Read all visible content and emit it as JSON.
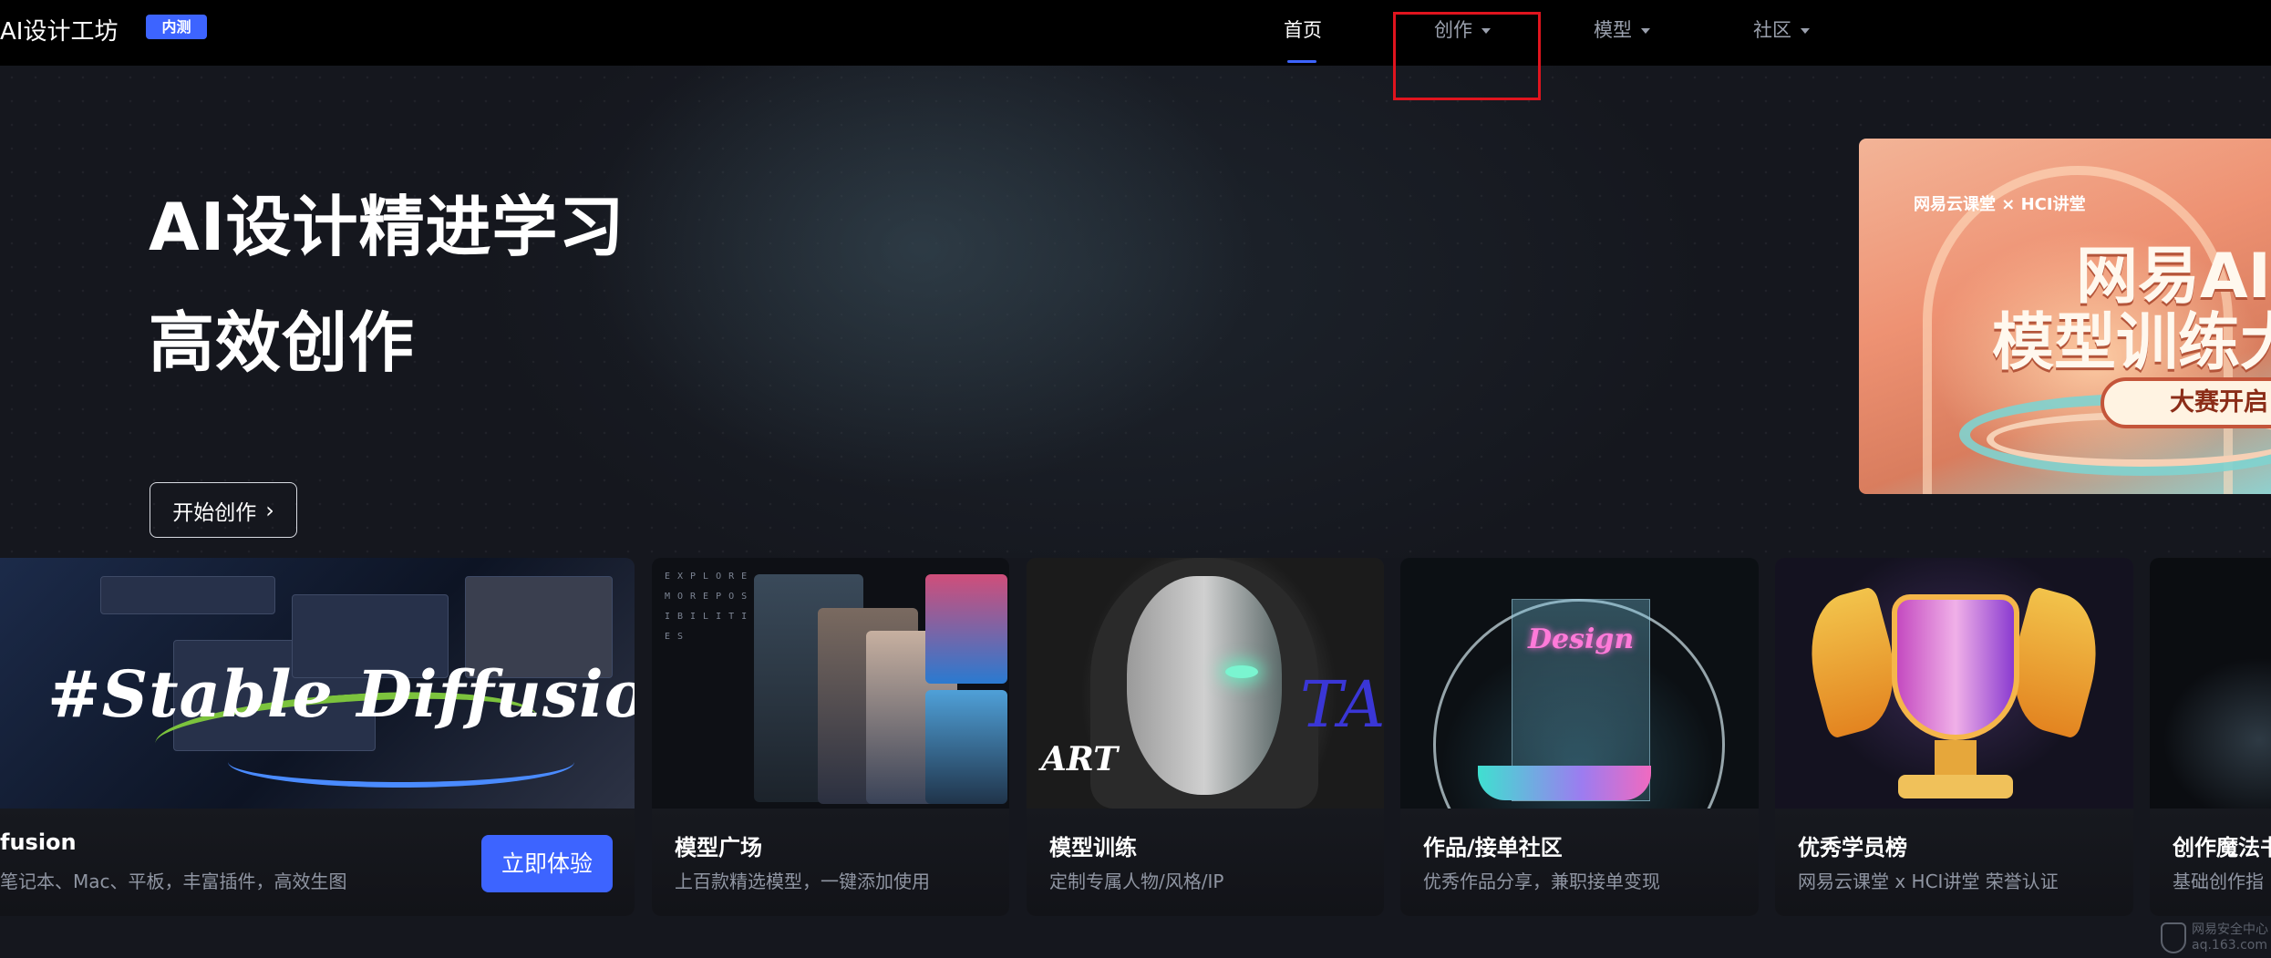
{
  "header": {
    "brand": "AI设计工坊",
    "badge": "内测",
    "nav": [
      {
        "label": "首页",
        "active": true
      },
      {
        "label": "创作",
        "has_dropdown": true
      },
      {
        "label": "模型",
        "has_dropdown": true
      },
      {
        "label": "社区",
        "has_dropdown": true
      }
    ]
  },
  "hero": {
    "title_line1": "AI设计精进学习",
    "title_line2": "高效创作",
    "cta": "开始创作"
  },
  "banner": {
    "logo_text": "网易云课堂 × HCI讲堂",
    "line1": "网易AI",
    "line2": "模型训练大",
    "button": "大赛开启"
  },
  "cards": [
    {
      "title": "fusion",
      "desc": "笔记本、Mac、平板，丰富插件，高效生图",
      "image_text": "#Stable Diffusion",
      "button": "立即体验"
    },
    {
      "title": "模型广场",
      "desc": "上百款精选模型，一键添加使用",
      "image_text": "EXPLORE MOREPOS IBILITI ES"
    },
    {
      "title": "模型训练",
      "desc": "定制专属人物/风格/IP",
      "image_text": "ART"
    },
    {
      "title": "作品/接单社区",
      "desc": "优秀作品分享，兼职接单变现",
      "image_text": "Design"
    },
    {
      "title": "优秀学员榜",
      "desc": "网易云课堂 x HCI讲堂 荣誉认证"
    },
    {
      "title": "创作魔法书",
      "desc": "基础创作指"
    }
  ],
  "watermark": {
    "line1": "网易安全中心",
    "line2": "aq.163.com"
  },
  "colors": {
    "accent": "#3d64ff",
    "highlight_box": "#e0141e",
    "background": "#15171e"
  }
}
